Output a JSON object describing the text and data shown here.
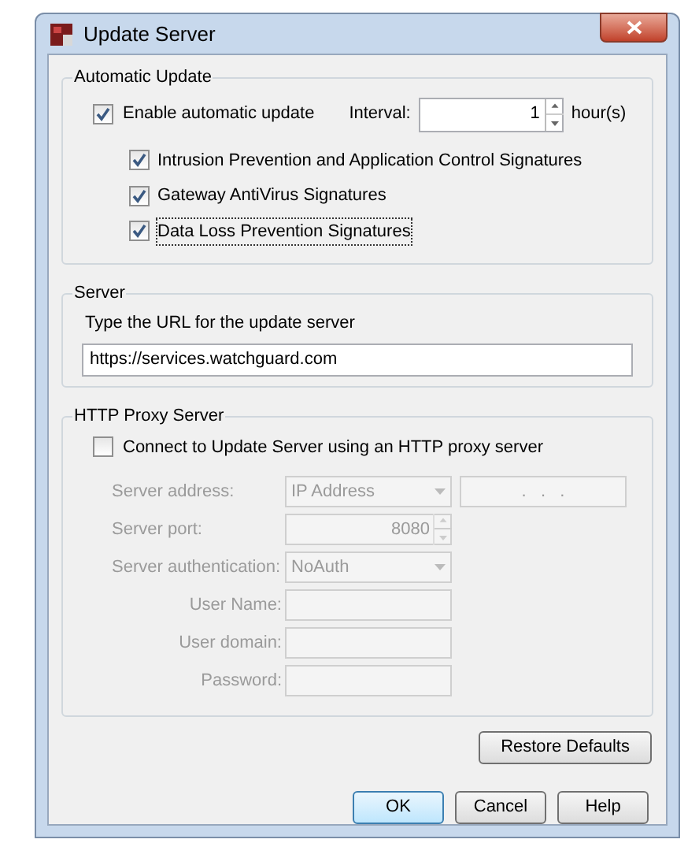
{
  "window": {
    "title": "Update Server"
  },
  "automatic_update": {
    "title": "Automatic Update",
    "enable": {
      "label": "Enable automatic update",
      "checked": true
    },
    "interval": {
      "label": "Interval:",
      "value": "1",
      "unit": "hour(s)"
    },
    "signatures": [
      {
        "label": "Intrusion Prevention and Application Control Signatures",
        "checked": true,
        "focused": false
      },
      {
        "label": "Gateway AntiVirus Signatures",
        "checked": true,
        "focused": false
      },
      {
        "label": "Data Loss Prevention Signatures",
        "checked": true,
        "focused": true
      }
    ]
  },
  "server": {
    "title": "Server",
    "instruction": "Type the URL for the update server",
    "url": "https://services.watchguard.com"
  },
  "proxy": {
    "title": "HTTP Proxy Server",
    "enable": {
      "label": "Connect to Update Server using an HTTP proxy server",
      "checked": false
    },
    "fields": [
      {
        "kind": "dropdown",
        "label": "Server address:",
        "value": "IP Address",
        "extra": ".   .   .",
        "disabled": true
      },
      {
        "kind": "spinner",
        "label": "Server port:",
        "value": "8080",
        "disabled": true
      },
      {
        "kind": "dropdown",
        "label": "Server authentication:",
        "value": "NoAuth",
        "disabled": true
      },
      {
        "kind": "text",
        "label": "User Name:",
        "disabled": true
      },
      {
        "kind": "text",
        "label": "User domain:",
        "disabled": true
      },
      {
        "kind": "text",
        "label": "Password:",
        "disabled": true
      }
    ]
  },
  "restore_button": "Restore Defaults",
  "buttons": [
    {
      "label": "OK",
      "default": true
    },
    {
      "label": "Cancel",
      "default": false
    },
    {
      "label": "Help",
      "default": false
    }
  ]
}
